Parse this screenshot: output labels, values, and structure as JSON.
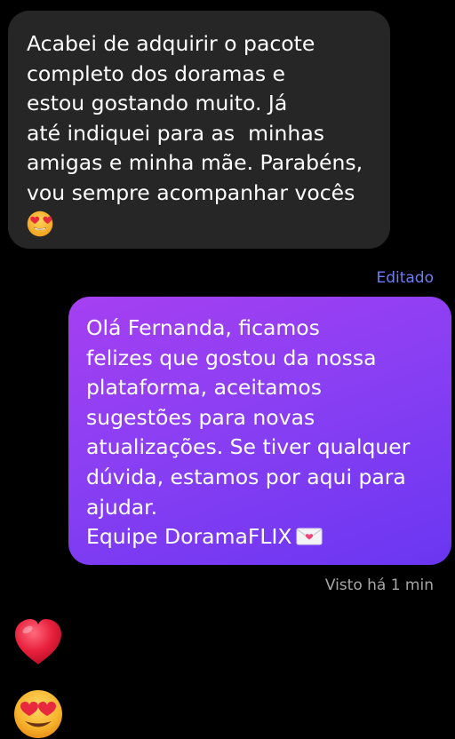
{
  "conversation": {
    "incoming": {
      "lines": [
        "Acabei de adquirir o pacote",
        "completo dos doramas e",
        "estou gostando muito. Já",
        "até indiquei para as  minhas",
        "amigas e minha mãe. Parabéns,",
        "vou sempre acompanhar vocês"
      ],
      "trailing_emoji": "smiling-face-with-heart-eyes"
    },
    "incoming_status": "Editado",
    "outgoing": {
      "lines": [
        "Olá Fernanda, ficamos",
        "felizes que gostou da nossa",
        "plataforma, aceitamos",
        "sugestões para novas",
        "atualizações. Se tiver qualquer",
        "dúvida, estamos por aqui para",
        "ajudar."
      ],
      "signature": "Equipe DoramaFLIX",
      "signature_emoji": "love-letter"
    },
    "outgoing_status": "Visto há 1 min",
    "reactions": [
      "red-heart",
      "smiling-face-with-heart-eyes"
    ]
  },
  "colors": {
    "background": "#000000",
    "incoming_bubble": "#262626",
    "outgoing_gradient_start": "#a63ff2",
    "outgoing_gradient_end": "#6a36f1",
    "edited_label": "#6f7cf2",
    "seen_label": "#a6a6a6"
  }
}
